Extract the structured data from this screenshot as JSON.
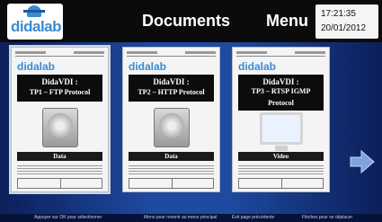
{
  "header": {
    "logo_text": "didalab",
    "title": "Documents",
    "menu_label": "Menu",
    "time": "17:21:35",
    "date": "20/01/2012"
  },
  "documents": [
    {
      "logo": "didalab",
      "title_line1": "DidaVDI :",
      "title_line2": "TP1 – FTP Protocol",
      "media": "hdd-icon",
      "tag": "Data",
      "selected": true
    },
    {
      "logo": "didalab",
      "title_line1": "DidaVDI :",
      "title_line2": "TP2 – HTTP Protocol",
      "media": "hdd-icon",
      "tag": "Data",
      "selected": false
    },
    {
      "logo": "didalab",
      "title_line1": "DidaVDI :",
      "title_line2": "TP3 – RTSP IGMP",
      "title_line3": "Protocol",
      "media": "monitor-icon",
      "tag": "Video",
      "selected": false
    }
  ],
  "next_arrow": "arrow-right-icon",
  "footer": {
    "hint_ok": "Appuyer sur OK pour sélectionner",
    "hint_menu": "Menu pour revenir au menu principal",
    "hint_exit": "Exit page précédente",
    "hint_arrows": "Flèches pour se déplacer"
  },
  "colors": {
    "header_bg": "#0b0b0b",
    "accent": "#3a8bd1",
    "strip": "#1e4aa0"
  }
}
